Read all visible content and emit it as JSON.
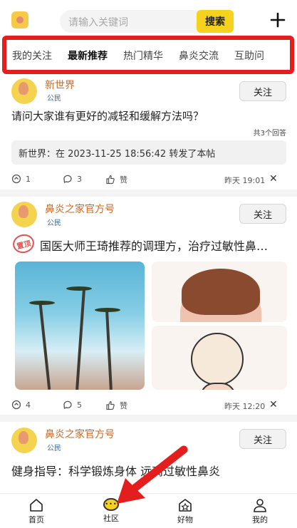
{
  "header": {
    "search_placeholder": "请输入关键词",
    "search_button": "搜索",
    "plus_icon": "plus-icon"
  },
  "tabs": [
    "我的关注",
    "最新推荐",
    "热门精华",
    "鼻炎交流",
    "互助问"
  ],
  "active_tab": 1,
  "posts": [
    {
      "author": "新世界",
      "role": "公民",
      "follow": "关注",
      "title": "请问大家谁有更好的减轻和缓解方法吗？",
      "answers": "共3个回答",
      "repost": "新世界：在 2023-11-25 18:56:42 转发了本帖",
      "share": "1",
      "comments": "3",
      "likes": "赞",
      "time": "昨天 19:01"
    },
    {
      "author": "鼻炎之家官方号",
      "role": "公民",
      "follow": "关注",
      "badge": "置顶",
      "title": "国医大师王琦推荐的调理方，治疗过敏性鼻…",
      "share": "4",
      "comments": "5",
      "likes": "赞",
      "time": "昨天 12:20"
    },
    {
      "author": "鼻炎之家官方号",
      "role": "公民",
      "follow": "关注",
      "title": "健身指导：科学锻炼身体 远离过敏性鼻炎"
    }
  ],
  "nav": [
    {
      "label": "首页",
      "icon": "home-icon"
    },
    {
      "label": "社区",
      "icon": "community-icon"
    },
    {
      "label": "好物",
      "icon": "shop-icon"
    },
    {
      "label": "我的",
      "icon": "profile-icon"
    }
  ],
  "colors": {
    "accent": "#f7d21c",
    "highlight_frame": "#e41d1d",
    "author": "#c96a24"
  }
}
